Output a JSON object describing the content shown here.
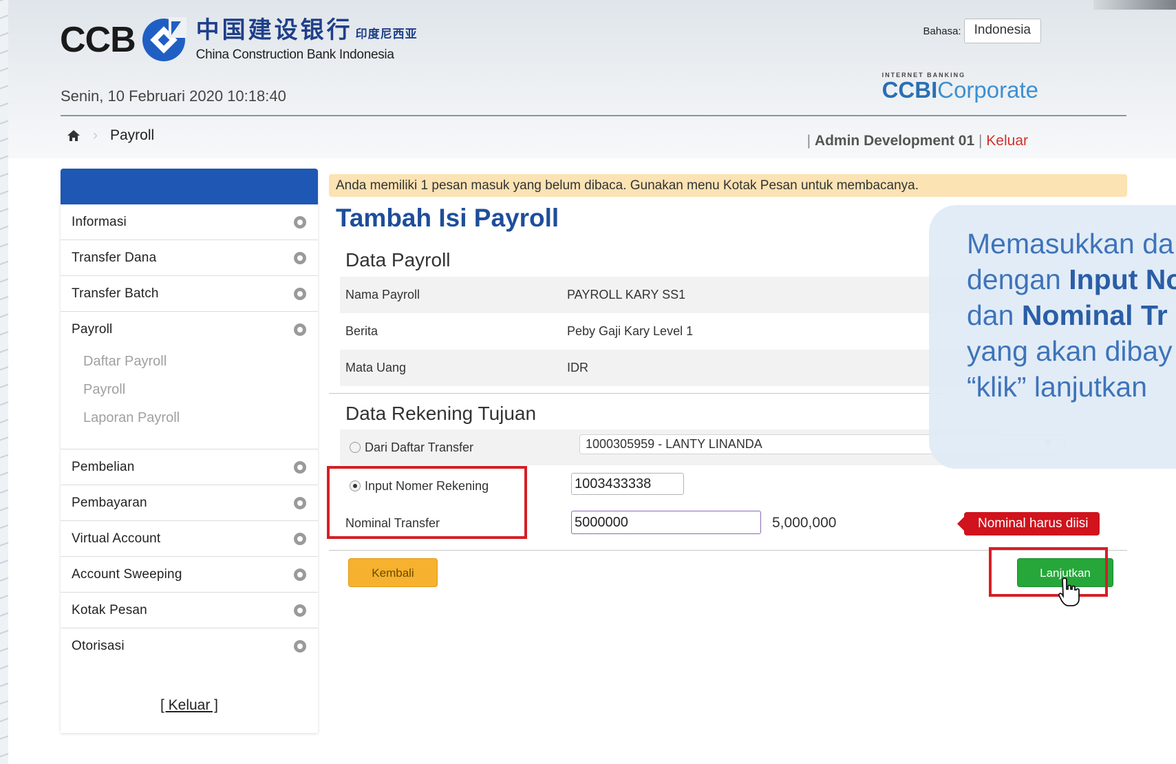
{
  "header": {
    "logo_ccb": "CCB",
    "logo_chinese": "中国建设银行",
    "logo_chinese_sub": "印度尼西亚",
    "logo_english": "China Construction Bank Indonesia",
    "language_label": "Bahasa:",
    "language_value": "Indonesia",
    "datetime": "Senin, 10 Februari 2020 10:18:40",
    "brand_small": "INTERNET BANKING",
    "brand_ccbi": "CCBI",
    "brand_corporate": "Corporate",
    "breadcrumb_current": "Payroll",
    "user_separator": "|",
    "user_name": "Admin Development 01",
    "logout_link": "Keluar"
  },
  "sidebar": {
    "items_top": [
      {
        "label": "Informasi"
      },
      {
        "label": "Transfer Dana"
      },
      {
        "label": "Transfer Batch"
      }
    ],
    "payroll": {
      "label": "Payroll",
      "sub_items": [
        "Daftar Payroll",
        "Payroll",
        "Laporan Payroll"
      ]
    },
    "items_bottom": [
      {
        "label": "Pembelian"
      },
      {
        "label": "Pembayaran"
      },
      {
        "label": "Virtual Account"
      },
      {
        "label": "Account Sweeping"
      },
      {
        "label": "Kotak Pesan"
      },
      {
        "label": "Otorisasi"
      }
    ],
    "logout": "[ Keluar ]"
  },
  "main": {
    "notice": "Anda memiliki 1 pesan masuk yang belum dibaca. Gunakan menu Kotak Pesan untuk membacanya.",
    "title": "Tambah Isi Payroll",
    "section_payroll": "Data Payroll",
    "payroll_rows": [
      {
        "label": "Nama Payroll",
        "value": "PAYROLL KARY SS1"
      },
      {
        "label": "Berita",
        "value": "Peby Gaji Kary Level 1"
      },
      {
        "label": "Mata Uang",
        "value": "IDR"
      }
    ],
    "section_tujuan": "Data Rekening Tujuan",
    "option_daftar": "Dari Daftar Transfer",
    "daftar_selected": "1000305959 - LANTY LINANDA",
    "option_input": "Input Nomer Rekening",
    "account_number": "1003433338",
    "nominal_label": "Nominal Transfer",
    "nominal_value": "5000000",
    "nominal_formatted": "5,000,000",
    "error_message": "Nominal harus diisi",
    "back_button": "Kembali",
    "next_button": "Lanjutkan"
  },
  "callout": {
    "line1": "Memasukkan da",
    "line2_prefix": "dengan ",
    "line2_bold": "Input No",
    "line3_prefix": "dan ",
    "line3_bold": "Nominal Tr",
    "line4": "yang akan dibay",
    "line5": "“klik” lanjutkan"
  },
  "colors": {
    "sidebar_header": "#1e57b4",
    "title": "#1e4e9a",
    "notice_bg": "#fbe3b4",
    "error": "#d0131d",
    "next_button": "#26a73a",
    "back_button": "#f6b12e",
    "highlight_box": "#d41f26"
  }
}
